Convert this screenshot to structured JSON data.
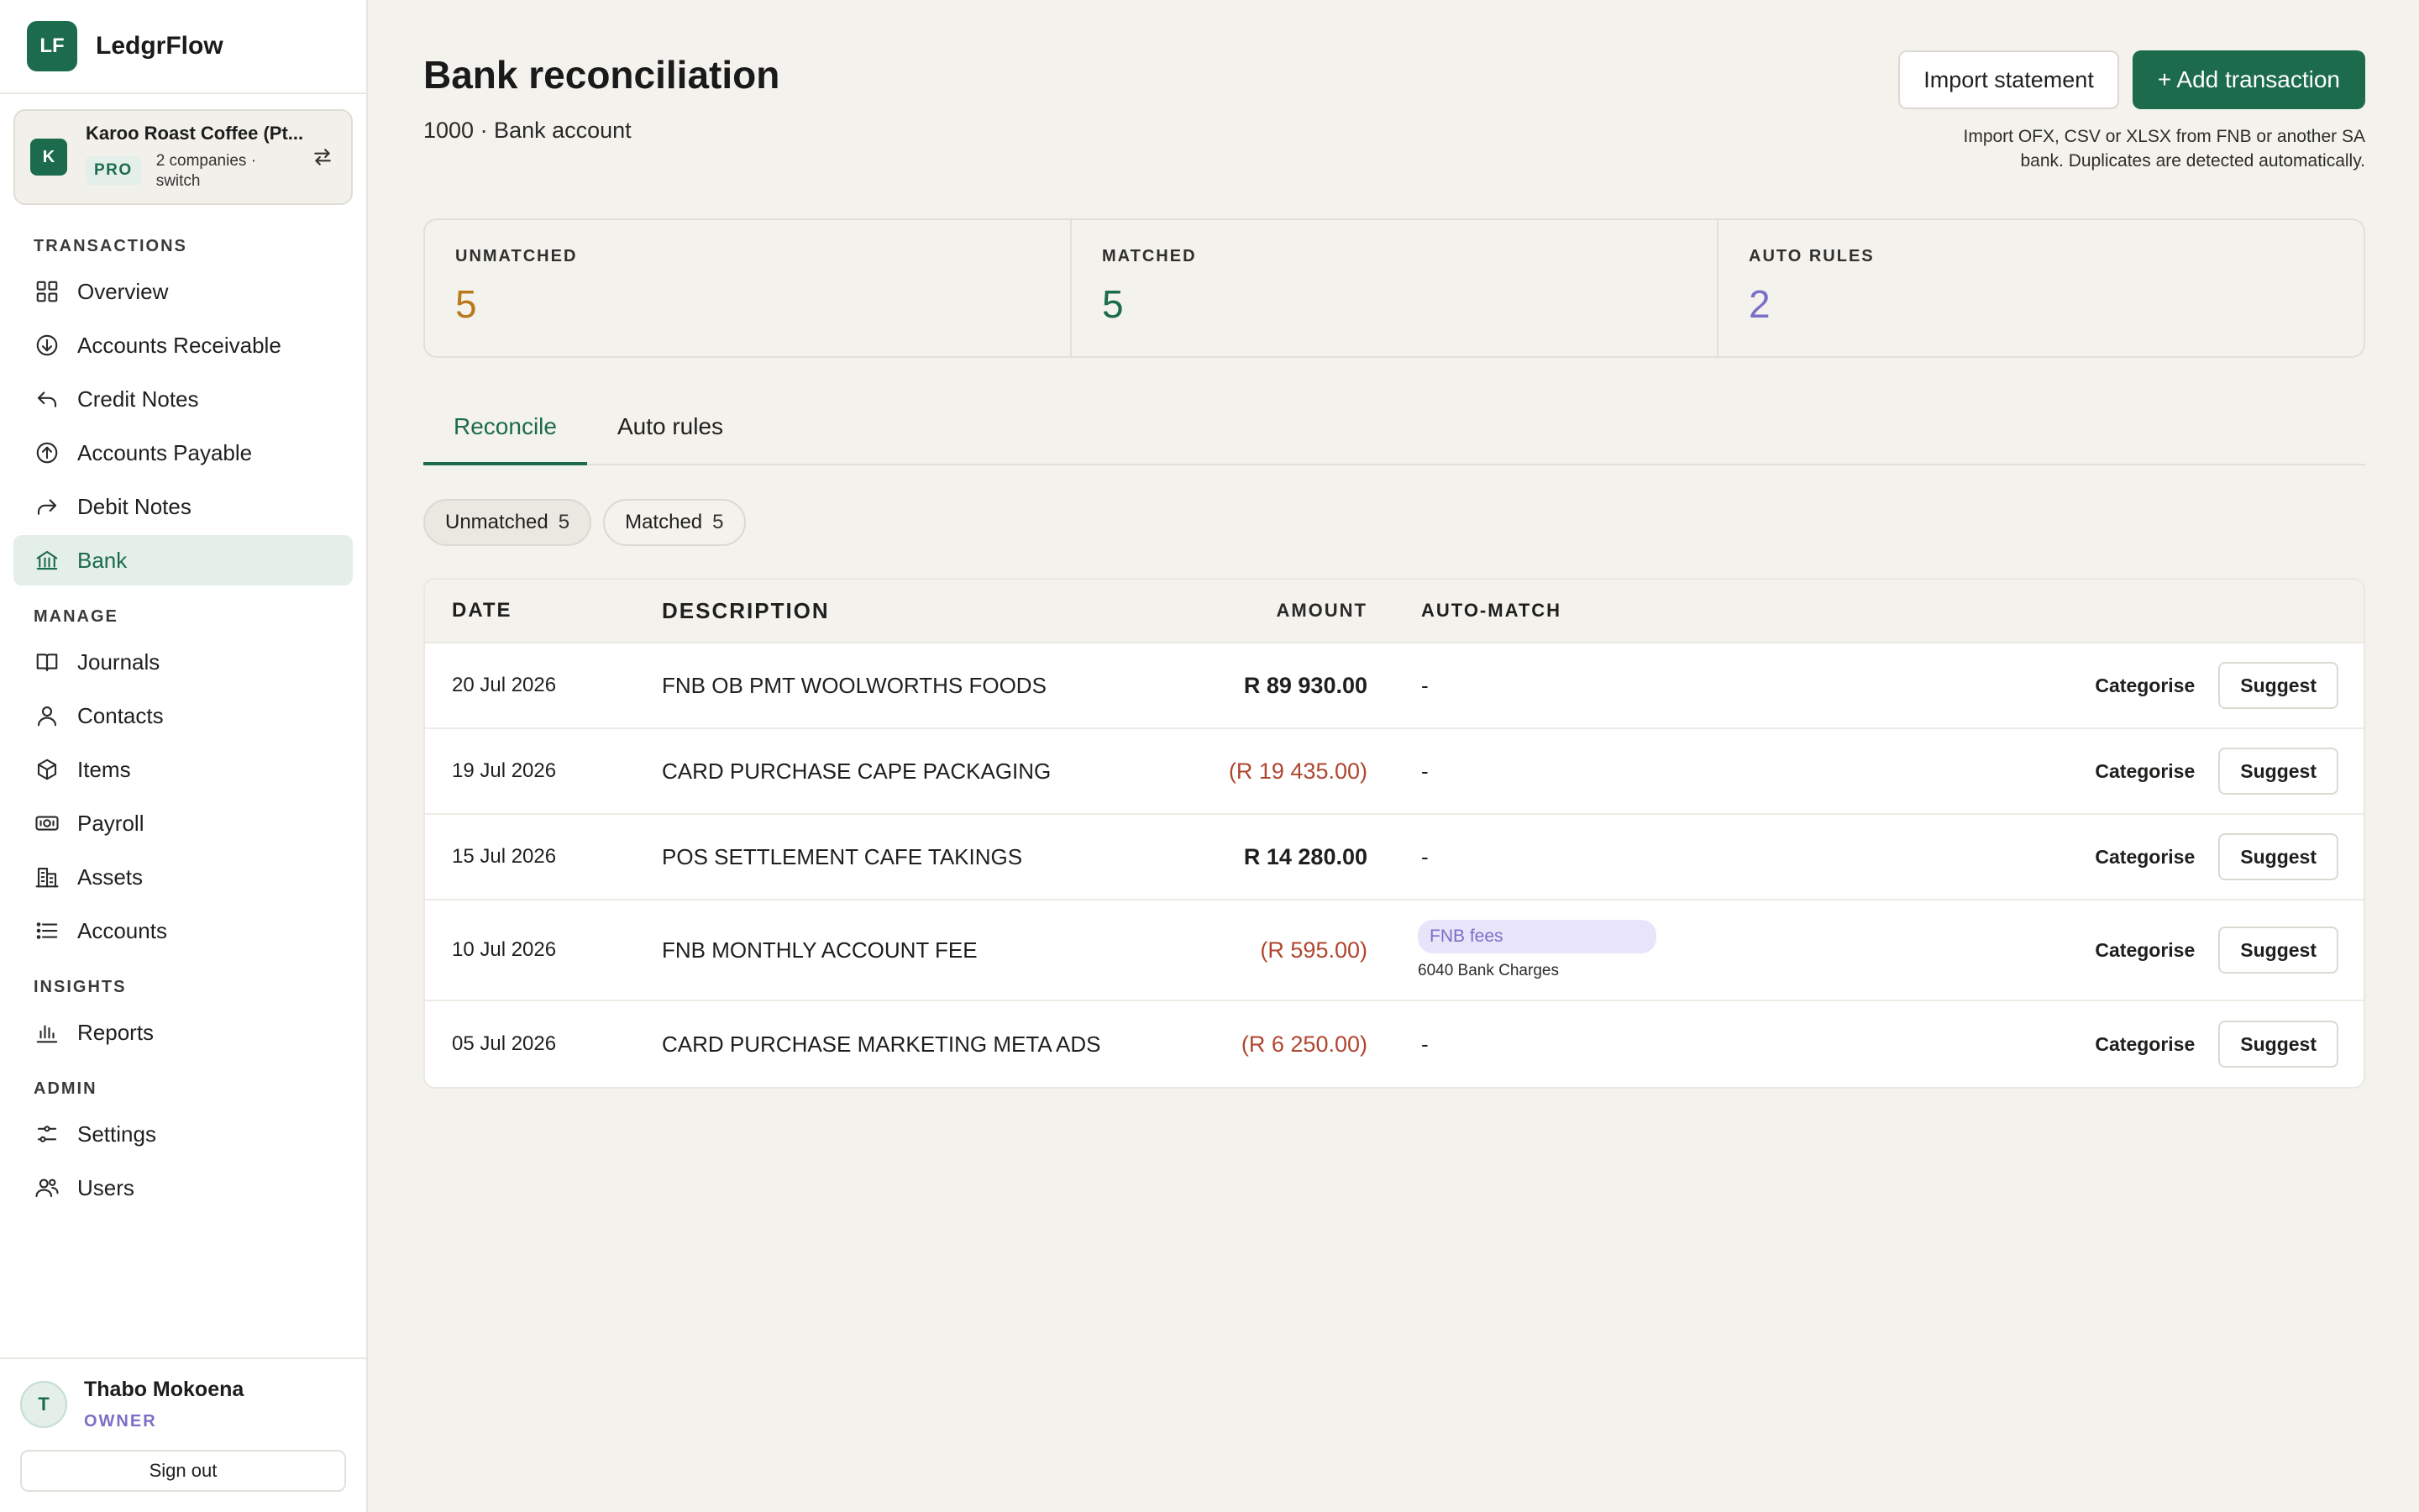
{
  "brand": {
    "logo": "LF",
    "name": "LedgrFlow"
  },
  "company": {
    "avatar": "K",
    "name": "Karoo Roast Coffee (Pt...",
    "plan": "PRO",
    "count": "2 companies · switch"
  },
  "nav": {
    "sections": [
      {
        "heading": "TRANSACTIONS",
        "items": [
          {
            "label": "Overview",
            "icon": "grid-icon"
          },
          {
            "label": "Accounts Receivable",
            "icon": "arrow-down-circle-icon"
          },
          {
            "label": "Credit Notes",
            "icon": "undo-arrow-icon"
          },
          {
            "label": "Accounts Payable",
            "icon": "arrow-up-circle-icon"
          },
          {
            "label": "Debit Notes",
            "icon": "redo-arrow-icon"
          },
          {
            "label": "Bank",
            "icon": "bank-icon",
            "active": true
          }
        ]
      },
      {
        "heading": "MANAGE",
        "items": [
          {
            "label": "Journals",
            "icon": "book-icon"
          },
          {
            "label": "Contacts",
            "icon": "person-icon"
          },
          {
            "label": "Items",
            "icon": "box-icon"
          },
          {
            "label": "Payroll",
            "icon": "cash-icon"
          },
          {
            "label": "Assets",
            "icon": "building-icon"
          },
          {
            "label": "Accounts",
            "icon": "list-icon"
          }
        ]
      },
      {
        "heading": "INSIGHTS",
        "items": [
          {
            "label": "Reports",
            "icon": "bar-chart-icon"
          }
        ]
      },
      {
        "heading": "ADMIN",
        "items": [
          {
            "label": "Settings",
            "icon": "sliders-icon"
          },
          {
            "label": "Users",
            "icon": "users-icon"
          }
        ]
      }
    ]
  },
  "user": {
    "avatar": "T",
    "name": "Thabo Mokoena",
    "role": "OWNER",
    "signout": "Sign out"
  },
  "header": {
    "title": "Bank reconciliation",
    "subtitle": "1000 · Bank account",
    "import_label": "Import statement",
    "add_label": "+ Add transaction",
    "import_hint": "Import OFX, CSV or XLSX from FNB or another SA bank. Duplicates are detected automatically."
  },
  "stats": [
    {
      "label": "UNMATCHED",
      "value": "5",
      "color": "#b87a1c"
    },
    {
      "label": "MATCHED",
      "value": "5",
      "color": "#1c6b4c"
    },
    {
      "label": "AUTO RULES",
      "value": "2",
      "color": "#7b6fc7"
    }
  ],
  "tabs": [
    {
      "label": "Reconcile",
      "active": true
    },
    {
      "label": "Auto rules",
      "active": false
    }
  ],
  "filters": [
    {
      "label": "Unmatched",
      "count": "5",
      "active": true
    },
    {
      "label": "Matched",
      "count": "5",
      "active": false
    }
  ],
  "table": {
    "headers": {
      "date": "DATE",
      "description": "DESCRIPTION",
      "amount": "AMOUNT",
      "auto_match": "AUTO-MATCH"
    },
    "categorise_label": "Categorise",
    "suggest_label": "Suggest",
    "rows": [
      {
        "date": "20 Jul 2026",
        "description": "FNB OB PMT WOOLWORTHS FOODS",
        "amount": "R 89 930.00",
        "negative": false,
        "match": "-"
      },
      {
        "date": "19 Jul 2026",
        "description": "CARD PURCHASE CAPE PACKAGING",
        "amount": "(R 19 435.00)",
        "negative": true,
        "match": "-"
      },
      {
        "date": "15 Jul 2026",
        "description": "POS SETTLEMENT CAFE TAKINGS",
        "amount": "R 14 280.00",
        "negative": false,
        "match": "-"
      },
      {
        "date": "10 Jul 2026",
        "description": "FNB MONTHLY ACCOUNT FEE",
        "amount": "(R 595.00)",
        "negative": true,
        "match_rule": "FNB fees",
        "match_account": "6040 Bank Charges"
      },
      {
        "date": "05 Jul 2026",
        "description": "CARD PURCHASE MARKETING META ADS",
        "amount": "(R 6 250.00)",
        "negative": true,
        "match": "-"
      }
    ]
  },
  "colors": {
    "accent": "#1c6b4c",
    "negative": "#b0462f",
    "rule": "#7b6fc7"
  }
}
